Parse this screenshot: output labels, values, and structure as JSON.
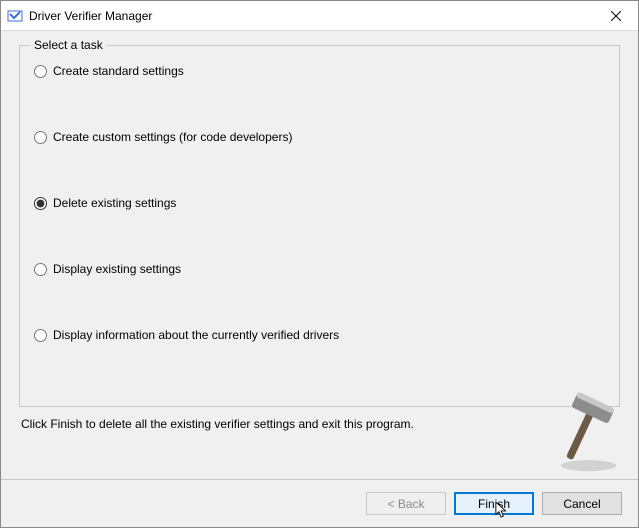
{
  "window": {
    "title": "Driver Verifier Manager"
  },
  "group": {
    "legend": "Select a task",
    "options": {
      "opt1": "Create standard settings",
      "opt2": "Create custom settings (for code developers)",
      "opt3": "Delete existing settings",
      "opt4": "Display existing settings",
      "opt5": "Display information about the currently verified drivers"
    },
    "selected": "opt3"
  },
  "instruction": "Click Finish to delete all the existing verifier settings and exit this program.",
  "buttons": {
    "back": "< Back",
    "finish": "Finish",
    "cancel": "Cancel"
  }
}
